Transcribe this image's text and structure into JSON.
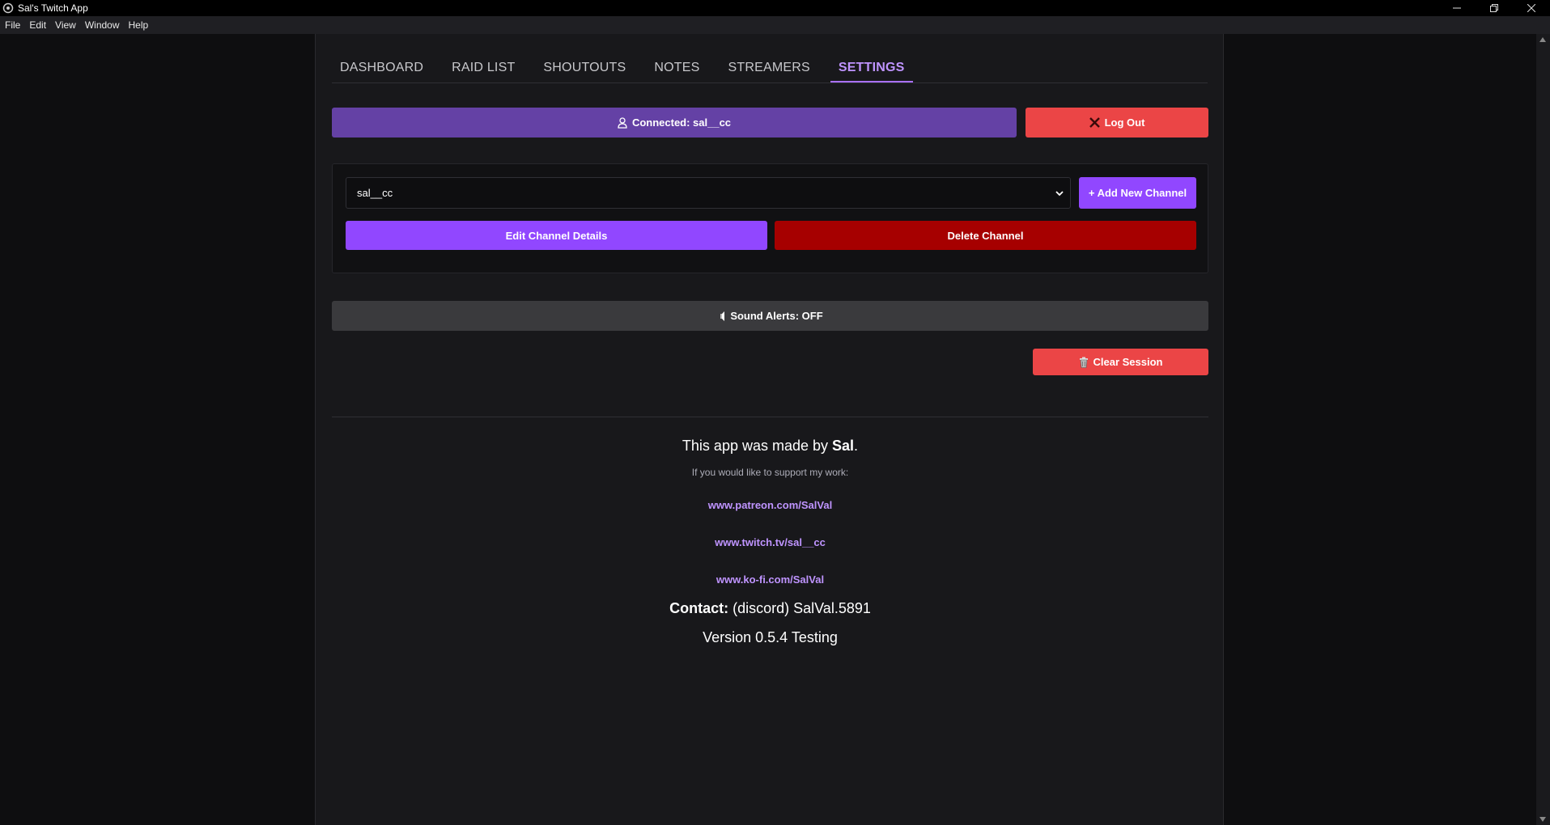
{
  "window": {
    "title": "Sal's Twitch App",
    "controls": [
      "minimize",
      "restore",
      "close"
    ]
  },
  "menu": [
    "File",
    "Edit",
    "View",
    "Window",
    "Help"
  ],
  "tabs": [
    {
      "label": "DASHBOARD",
      "active": false
    },
    {
      "label": "RAID LIST",
      "active": false
    },
    {
      "label": "SHOUTOUTS",
      "active": false
    },
    {
      "label": "NOTES",
      "active": false
    },
    {
      "label": "STREAMERS",
      "active": false
    },
    {
      "label": "SETTINGS",
      "active": true
    }
  ],
  "account": {
    "connected_label": "Connected: sal__cc",
    "logout_label": "Log Out"
  },
  "channel": {
    "selected": "sal__cc",
    "add_label": "+ Add New Channel",
    "edit_label": "Edit Channel Details",
    "delete_label": "Delete Channel"
  },
  "sound": {
    "label": "Sound Alerts: OFF"
  },
  "session": {
    "clear_label": "Clear Session"
  },
  "credits": {
    "made_by_prefix": "This app was made by ",
    "made_by_name": "Sal",
    "made_by_suffix": ".",
    "support_text": "If you would like to support my work:",
    "links": [
      "www.patreon.com/SalVal",
      "www.twitch.tv/sal__cc",
      "www.ko-fi.com/SalVal"
    ],
    "contact_label": "Contact:",
    "contact_value": " (discord) SalVal.5891",
    "version": "Version 0.5.4 Testing"
  },
  "colors": {
    "background": "#0e0e10",
    "panel": "#18181b",
    "twitch_purple": "#9147ff",
    "connected_purple": "#6441a5",
    "danger_red": "#eb4546",
    "dark_red": "#a60000",
    "link_purple": "#bf94ff"
  }
}
